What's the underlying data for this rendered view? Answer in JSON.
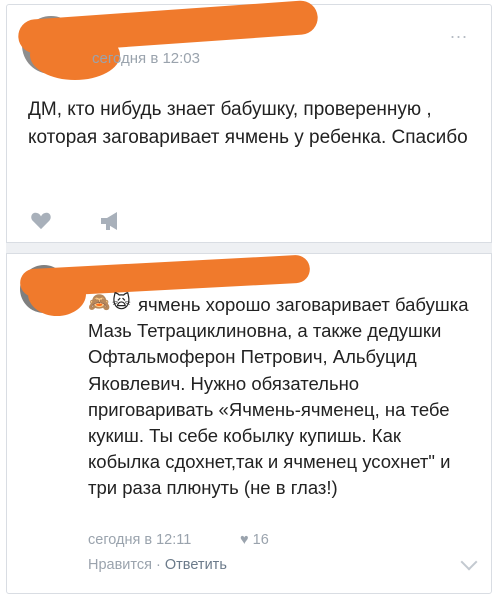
{
  "post": {
    "time": "сегодня в 12:03",
    "more": "...",
    "text": "ДМ, кто нибудь знает бабушку, проверенную , которая заговаривает ячмень у ребенка. Спасибо"
  },
  "comment": {
    "emoji_1": "🙈",
    "emoji_2": "🙀",
    "text": "ячмень хорошо заговаривает бабушка Мазь Тетрациклиновна, а также дедушки Офтальмоферон Петрович, Альбуцид Яковлевич. Нужно обязательно приговаривать «Ячмень-ячменец, на тебе кукиш. Ты себе кобылку купишь. Как кобылка сдохнет,так и ячменец усохнет\" и три раза плюнуть (не в глаз!)",
    "time": "сегодня в 12:11",
    "likes_icon": "♥",
    "likes_count": "16",
    "like_label": "Нравится",
    "separator": "·",
    "reply_label": "Ответить"
  },
  "colors": {
    "redaction": "#f07a2c",
    "meta_text": "#9aa3ad"
  }
}
